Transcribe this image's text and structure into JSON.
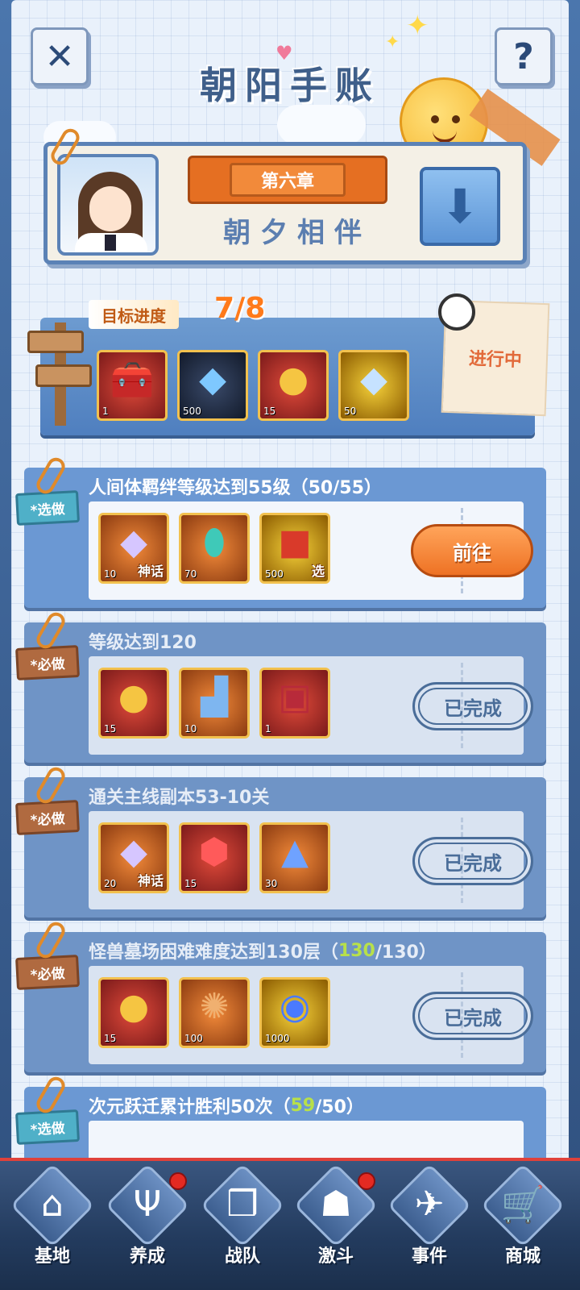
{
  "header": {
    "title": "朝阳手账",
    "close_icon": "close-icon",
    "help_label": "?"
  },
  "chapter": {
    "label": "第六章",
    "name": "朝夕相伴",
    "expand_icon": "arrow-down-icon"
  },
  "progress": {
    "label": "目标进度",
    "value": "7/8",
    "status": "进行中",
    "rewards": [
      {
        "icon": "treasure-chest-icon",
        "qty": "1"
      },
      {
        "icon": "blue-crystal-icon",
        "qty": "500"
      },
      {
        "icon": "gold-coin-icon",
        "qty": "15"
      },
      {
        "icon": "rainbow-crystal-icon",
        "qty": "50"
      }
    ]
  },
  "tasks": [
    {
      "type": "*选做",
      "title": "人间体羁绊等级达到55级（50/55）",
      "action": "前往",
      "rewards": [
        {
          "icon": "myth-crystal-icon",
          "qty": "10",
          "tag": "神话"
        },
        {
          "icon": "egg-card-icon",
          "qty": "70",
          "tag": ""
        },
        {
          "icon": "select-box-icon",
          "qty": "500",
          "tag": "选"
        }
      ]
    },
    {
      "type": "*必做",
      "title": "等级达到120",
      "action": "已完成",
      "rewards": [
        {
          "icon": "legend-coin-icon",
          "qty": "15",
          "tag": ""
        },
        {
          "icon": "blue-anvil-icon",
          "qty": "10",
          "tag": ""
        },
        {
          "icon": "red-chest-icon",
          "qty": "1",
          "tag": ""
        }
      ]
    },
    {
      "type": "*必做",
      "title": "通关主线副本53-10关",
      "action": "已完成",
      "rewards": [
        {
          "icon": "myth-crystal-icon",
          "qty": "20",
          "tag": "神话"
        },
        {
          "icon": "red-gem-icon",
          "qty": "15",
          "tag": ""
        },
        {
          "icon": "blue-badge-icon",
          "qty": "30",
          "tag": ""
        }
      ]
    },
    {
      "type": "*必做",
      "title_pre": "怪兽墓场困难难度达到130层（",
      "title_hl": "130",
      "title_post": "/130）",
      "action": "已完成",
      "rewards": [
        {
          "icon": "legend-coin-icon",
          "qty": "15",
          "tag": ""
        },
        {
          "icon": "bronze-gear-icon",
          "qty": "100",
          "tag": ""
        },
        {
          "icon": "blue-orb-icon",
          "qty": "1000",
          "tag": ""
        }
      ]
    },
    {
      "type": "*选做",
      "title_pre": "次元跃迁累计胜利50次（",
      "title_hl": "59",
      "title_post": "/50）"
    }
  ],
  "nav": [
    {
      "label": "基地",
      "icon": "base-icon",
      "badge": false
    },
    {
      "label": "养成",
      "icon": "training-icon",
      "badge": true
    },
    {
      "label": "战队",
      "icon": "team-cards-icon",
      "badge": false
    },
    {
      "label": "激斗",
      "icon": "battle-helmet-icon",
      "badge": true
    },
    {
      "label": "事件",
      "icon": "jet-event-icon",
      "badge": false
    },
    {
      "label": "商城",
      "icon": "shop-cart-icon",
      "badge": false
    }
  ]
}
